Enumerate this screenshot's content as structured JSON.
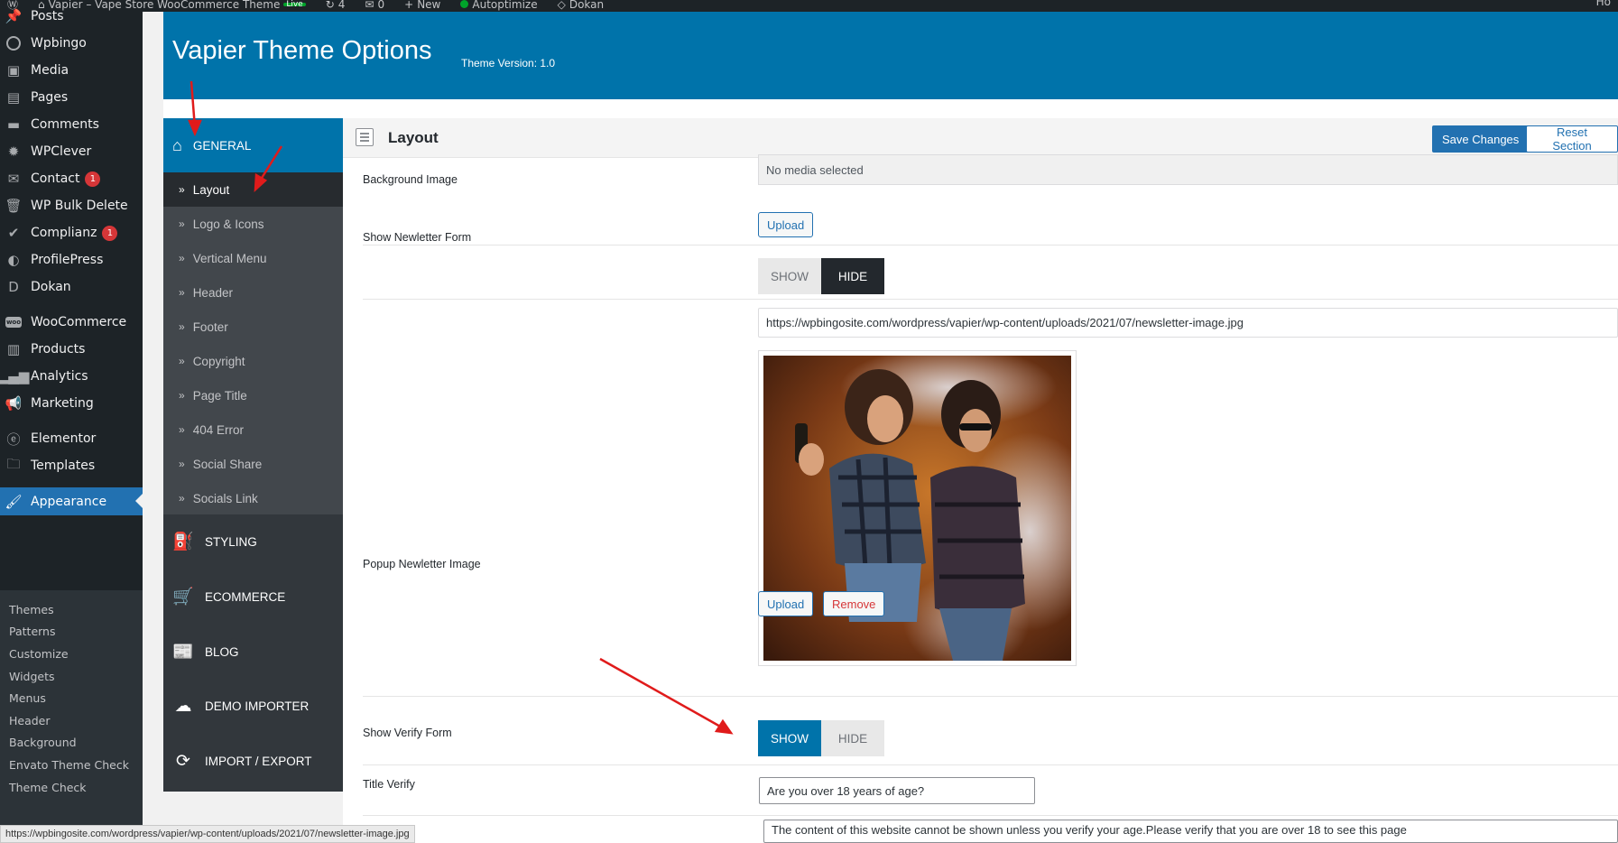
{
  "adminbar": {
    "site_name": "Vapier – Vape Store WooCommerce Theme",
    "live_badge": "Live",
    "comments_count": "4",
    "updates_count": "0",
    "new_label": "New",
    "autoptimize_label": "Autoptimize",
    "dokan_label": "Dokan",
    "right_label": "Ho"
  },
  "admin_menu": {
    "items": [
      {
        "label": "Posts",
        "icon": "pin-icon"
      },
      {
        "label": "Wpbingo",
        "icon": "wpbingo-icon"
      },
      {
        "label": "Media",
        "icon": "media-icon"
      },
      {
        "label": "Pages",
        "icon": "pages-icon"
      },
      {
        "label": "Comments",
        "icon": "comments-icon"
      },
      {
        "label": "WPClever",
        "icon": "wpclever-icon"
      },
      {
        "label": "Contact",
        "icon": "mail-icon",
        "badge": "1"
      },
      {
        "label": "WP Bulk Delete",
        "icon": "trash-icon"
      },
      {
        "label": "Complianz",
        "icon": "check-icon",
        "badge": "1"
      },
      {
        "label": "ProfilePress",
        "icon": "profilepress-icon"
      },
      {
        "label": "Dokan",
        "icon": "dokan-icon"
      },
      {
        "label": "WooCommerce",
        "icon": "woo-icon"
      },
      {
        "label": "Products",
        "icon": "products-icon"
      },
      {
        "label": "Analytics",
        "icon": "analytics-icon"
      },
      {
        "label": "Marketing",
        "icon": "megaphone-icon"
      },
      {
        "label": "Elementor",
        "icon": "elementor-icon"
      },
      {
        "label": "Templates",
        "icon": "folder-icon"
      },
      {
        "label": "Appearance",
        "icon": "brush-icon",
        "active": true
      }
    ],
    "appearance_submenu": [
      "Themes",
      "Patterns",
      "Customize",
      "Widgets",
      "Menus",
      "Header",
      "Background",
      "Envato Theme Check",
      "Theme Check"
    ]
  },
  "header": {
    "title": "Vapier Theme Options",
    "version": "Theme Version: 1.0"
  },
  "redux_menu": {
    "general": "GENERAL",
    "general_subs": [
      "Layout",
      "Logo & Icons",
      "Vertical Menu",
      "Header",
      "Footer",
      "Copyright",
      "Page Title",
      "404 Error",
      "Social Share",
      "Socials Link"
    ],
    "sections": [
      {
        "label": "STYLING",
        "icon": "styling-icon"
      },
      {
        "label": "ECOMMERCE",
        "icon": "cart-icon"
      },
      {
        "label": "BLOG",
        "icon": "blog-icon"
      },
      {
        "label": "DEMO IMPORTER",
        "icon": "cloud-download-icon"
      },
      {
        "label": "IMPORT / EXPORT",
        "icon": "refresh-icon"
      }
    ]
  },
  "section": {
    "title": "Layout",
    "save_label": "Save Changes",
    "reset_label": "Reset Section"
  },
  "fields": {
    "background_image": {
      "label": "Background Image",
      "value": "No media selected",
      "upload_label": "Upload"
    },
    "show_newsletter": {
      "label": "Show Newletter Form",
      "show_label": "SHOW",
      "hide_label": "HIDE",
      "selected": "HIDE"
    },
    "popup_newsletter_image": {
      "label": "Popup Newletter Image",
      "url": "https://wpbingosite.com/wordpress/vapier/wp-content/uploads/2021/07/newsletter-image.jpg",
      "upload_label": "Upload",
      "remove_label": "Remove"
    },
    "show_verify": {
      "label": "Show Verify Form",
      "show_label": "SHOW",
      "hide_label": "HIDE",
      "selected": "SHOW"
    },
    "title_verify": {
      "label": "Title Verify",
      "value": "Are you over 18 years of age?"
    },
    "content_verify": {
      "value": "The content of this website cannot be shown unless you verify your age.Please verify that you are over 18 to see this page"
    }
  },
  "statusbar": {
    "url": "https://wpbingosite.com/wordpress/vapier/wp-content/uploads/2021/07/newsletter-image.jpg"
  },
  "colors": {
    "wp_dark": "#1d2327",
    "wp_blue": "#0073aa",
    "accent": "#2271b1",
    "annotation_arrow": "#e01b1b"
  }
}
